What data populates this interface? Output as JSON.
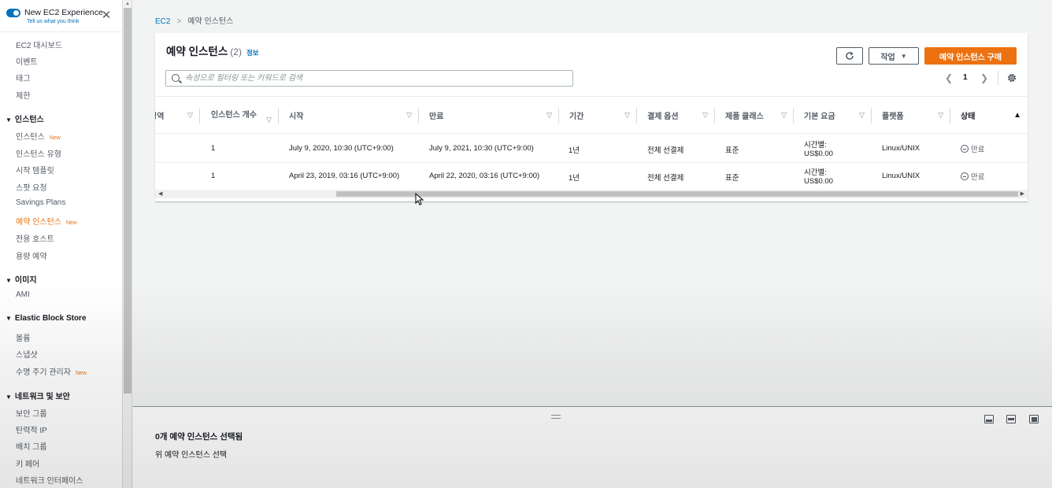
{
  "new_experience": {
    "title": "New EC2 Experience",
    "subtitle": "Tell us what you think",
    "toggle_on": true
  },
  "sidebar": {
    "top_items": [
      {
        "label": "EC2 대시보드"
      },
      {
        "label": "이벤트"
      },
      {
        "label": "태그"
      },
      {
        "label": "제한"
      }
    ],
    "sections": [
      {
        "title": "인스턴스",
        "items": [
          {
            "label": "인스턴스",
            "badge": "New"
          },
          {
            "label": "인스턴스 유형",
            "badge": ""
          },
          {
            "label": "시작 템플릿",
            "badge": ""
          },
          {
            "label": "스팟 요청",
            "badge": ""
          },
          {
            "label": "Savings Plans",
            "badge": ""
          },
          {
            "label": "예약 인스턴스",
            "badge": "New",
            "active": true
          },
          {
            "label": "전용 호스트",
            "badge": ""
          },
          {
            "label": "용량 예약",
            "badge": ""
          }
        ]
      },
      {
        "title": "이미지",
        "items": [
          {
            "label": "AMI",
            "badge": ""
          }
        ]
      },
      {
        "title": "Elastic Block Store",
        "items": [
          {
            "label": "볼륨",
            "badge": ""
          },
          {
            "label": "스냅샷",
            "badge": ""
          },
          {
            "label": "수명 주기 관리자",
            "badge": "New"
          }
        ]
      },
      {
        "title": "네트워크 및 보안",
        "items": [
          {
            "label": "보안 그룹",
            "badge": ""
          },
          {
            "label": "탄력적 IP",
            "badge": ""
          },
          {
            "label": "배치 그룹",
            "badge": ""
          },
          {
            "label": "키 페어",
            "badge": ""
          },
          {
            "label": "네트워크 인터페이스",
            "badge": ""
          }
        ]
      }
    ]
  },
  "breadcrumb": {
    "root": "EC2",
    "current": "예약 인스턴스"
  },
  "panel": {
    "title": "예약 인스턴스",
    "count": "(2)",
    "info": "정보",
    "actions_label": "작업",
    "purchase_label": "예약 인스턴스 구매",
    "search_placeholder": "속성으로 필터링 또는 키워드로 검색",
    "search_value": "",
    "page_number": "1"
  },
  "table": {
    "columns": [
      {
        "label": "영역"
      },
      {
        "label": "인스턴스 개수"
      },
      {
        "label": "시작"
      },
      {
        "label": "만료"
      },
      {
        "label": "기간"
      },
      {
        "label": "결제 옵션"
      },
      {
        "label": "제품 클래스"
      },
      {
        "label": "기본 요금"
      },
      {
        "label": "플랫폼"
      },
      {
        "label": "상태"
      }
    ],
    "rows": [
      {
        "count": "1",
        "start": "July 9, 2020, 10:30 (UTC+9:00)",
        "end": "July 9, 2021, 10:30 (UTC+9:00)",
        "term": "1년",
        "payment": "전체 선결제",
        "class": "표준",
        "rate_line1": "시간별:",
        "rate_line2": "US$0.00",
        "platform": "Linux/UNIX",
        "status": "만료"
      },
      {
        "count": "1",
        "start": "April 23, 2019, 03:16 (UTC+9:00)",
        "end": "April 22, 2020, 03:16 (UTC+9:00)",
        "term": "1년",
        "payment": "전체 선결제",
        "class": "표준",
        "rate_line1": "시간별:",
        "rate_line2": "US$0.00",
        "platform": "Linux/UNIX",
        "status": "만료"
      }
    ]
  },
  "split_panel": {
    "title": "0개 예약 인스턴스 선택됨",
    "subtitle": "위 예약 인스턴스 선택"
  },
  "colors": {
    "accent": "#ec7211",
    "link": "#0073bb",
    "text": "#16191f"
  }
}
